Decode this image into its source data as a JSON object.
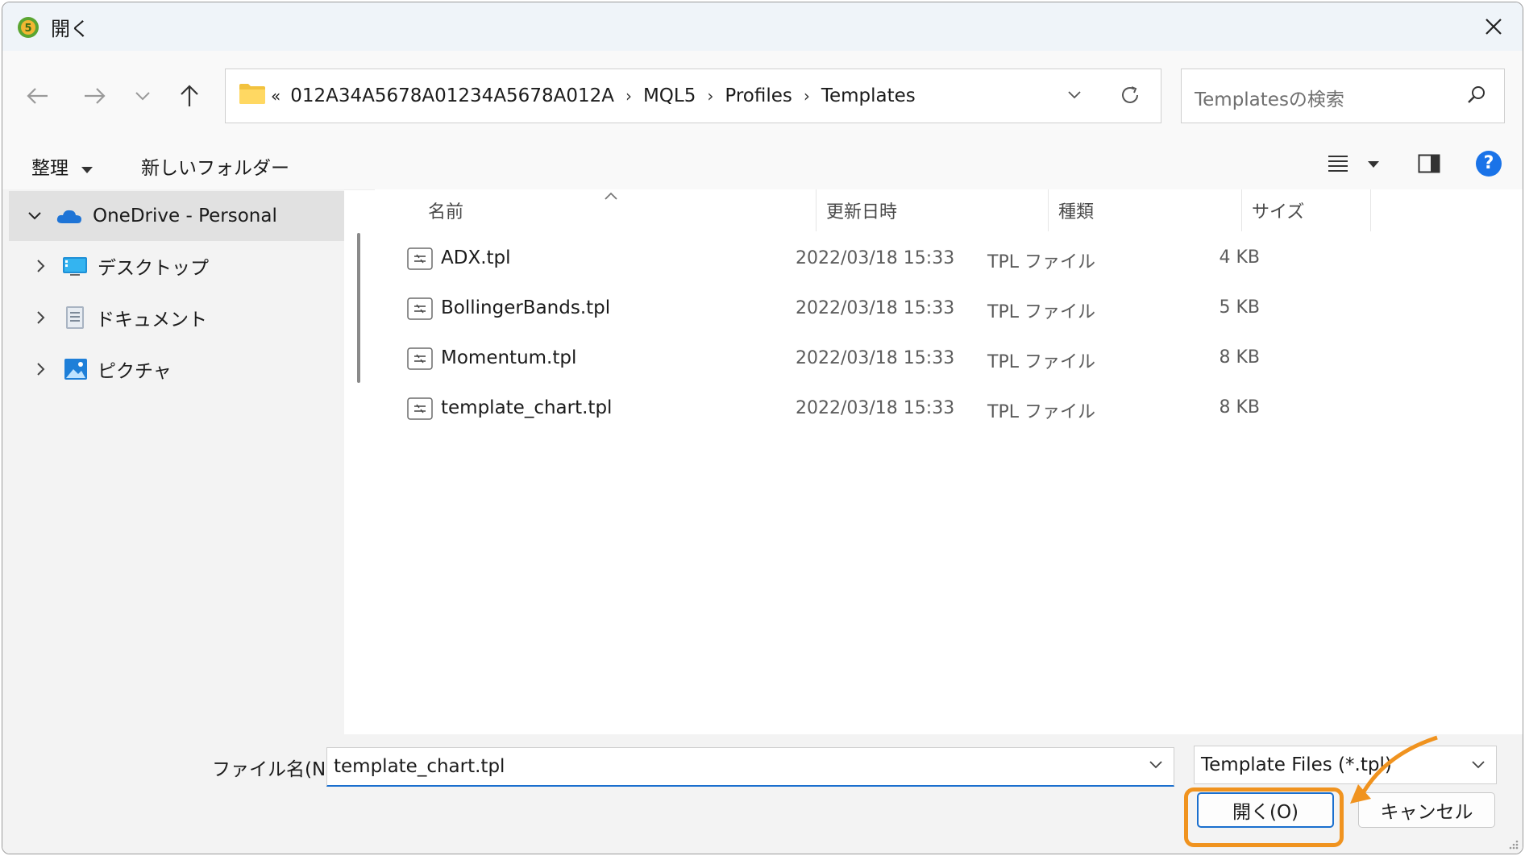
{
  "window": {
    "title": "開く",
    "app_icon": "mt5-app-icon",
    "close_icon": "close-icon"
  },
  "navigation": {
    "back_icon": "arrow-left-icon",
    "forward_icon": "arrow-right-icon",
    "recent_icon": "chevron-down-icon",
    "up_icon": "arrow-up-icon",
    "address": {
      "overflow": "«",
      "crumbs": [
        "012A34A5678A01234A5678A012A",
        "MQL5",
        "Profiles",
        "Templates"
      ],
      "separator": "›"
    },
    "refresh_icon": "refresh-icon",
    "search_placeholder": "Templatesの検索",
    "search_icon": "search-icon"
  },
  "command_bar": {
    "organize_label": "整理",
    "new_folder_label": "新しいフォルダー",
    "view_icon": "list-view-icon",
    "preview_pane_icon": "preview-pane-icon",
    "help_label": "?"
  },
  "sidebar": {
    "items": [
      {
        "label": "OneDrive - Personal",
        "icon": "onedrive-cloud-icon",
        "expanded": true,
        "selected": true
      },
      {
        "label": "デスクトップ",
        "icon": "desktop-icon",
        "expanded": false
      },
      {
        "label": "ドキュメント",
        "icon": "documents-icon",
        "expanded": false
      },
      {
        "label": "ピクチャ",
        "icon": "pictures-icon",
        "expanded": false
      }
    ]
  },
  "file_list": {
    "columns": [
      "名前",
      "更新日時",
      "種類",
      "サイズ"
    ],
    "sort_indicator": "^",
    "rows": [
      {
        "name": "ADX.tpl",
        "date": "2022/03/18 15:33",
        "type": "TPL ファイル",
        "size": "4 KB"
      },
      {
        "name": "BollingerBands.tpl",
        "date": "2022/03/18 15:33",
        "type": "TPL ファイル",
        "size": "5 KB"
      },
      {
        "name": "Momentum.tpl",
        "date": "2022/03/18 15:33",
        "type": "TPL ファイル",
        "size": "8 KB"
      },
      {
        "name": "template_chart.tpl",
        "date": "2022/03/18 15:33",
        "type": "TPL ファイル",
        "size": "8 KB"
      }
    ]
  },
  "footer": {
    "filename_label": "ファイル名(N):",
    "filename_value": "template_chart.tpl",
    "filetype_value": "Template Files (*.tpl)",
    "open_label": "開く(O)",
    "cancel_label": "キャンセル"
  },
  "colors": {
    "highlight": "#f0931f",
    "accent": "#1a6fce",
    "titlebar": "#eff4f9"
  }
}
